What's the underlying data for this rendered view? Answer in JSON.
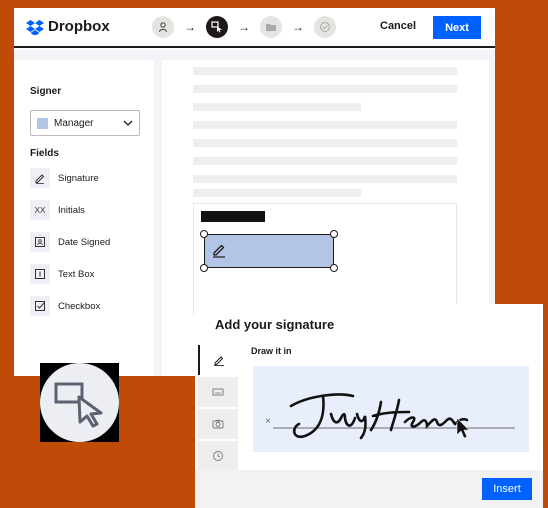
{
  "header": {
    "logo_text": "Dropbox",
    "cancel_label": "Cancel",
    "next_label": "Next",
    "steps": [
      "person-icon",
      "cursor-box-icon",
      "folder-icon",
      "check-circle-icon"
    ]
  },
  "sidebar": {
    "signer_label": "Signer",
    "signer_value": "Manager",
    "fields_label": "Fields",
    "fields": [
      {
        "label": "Signature",
        "icon": "pen-icon"
      },
      {
        "label": "Initials",
        "icon_text": "XX"
      },
      {
        "label": "Date Signed",
        "icon": "calendar-icon"
      },
      {
        "label": "Text Box",
        "icon": "textbox-icon"
      },
      {
        "label": "Checkbox",
        "icon": "checkbox-icon"
      }
    ]
  },
  "modal": {
    "title": "Add your signature",
    "draw_label": "Draw it in",
    "x_mark": "×",
    "insert_label": "Insert"
  },
  "colors": {
    "accent": "#0061fe",
    "background": "#c04a08",
    "field_fill": "#b3c5e6"
  }
}
